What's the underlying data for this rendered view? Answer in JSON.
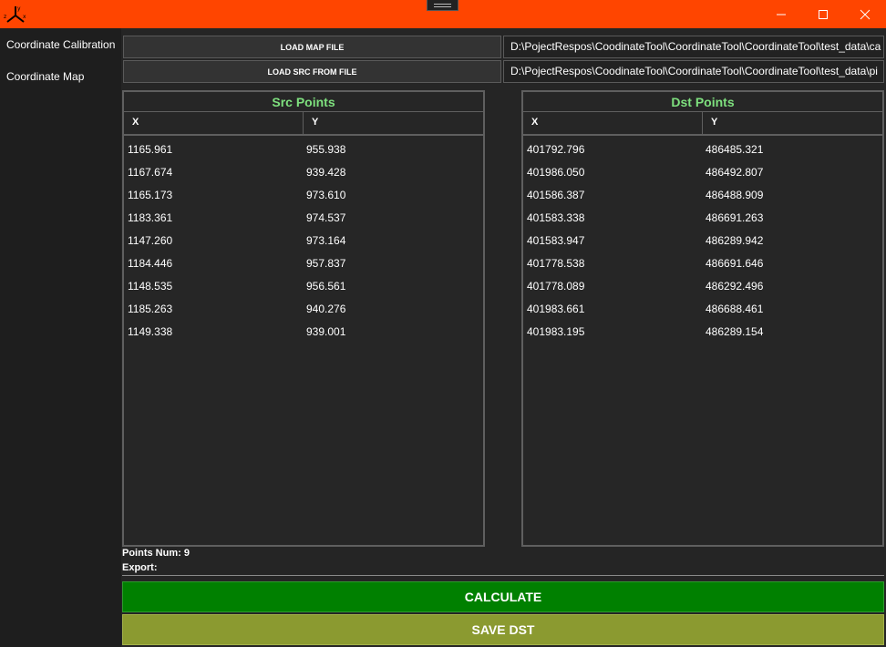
{
  "window": {
    "controls": {
      "minimize_icon": "minimize-icon",
      "maximize_icon": "maximize-icon",
      "close_icon": "close-icon"
    },
    "title_bar_color": "#ff4500"
  },
  "nav": {
    "items": [
      {
        "label": "Coordinate Calibration"
      },
      {
        "label": "Coordinate Map"
      }
    ]
  },
  "loaders": {
    "map": {
      "button_label": "LOAD MAP FILE",
      "path": "D:\\PojectRespos\\CoodinateTool\\CoordinateTool\\CoordinateTool\\test_data\\ca"
    },
    "src": {
      "button_label": "LOAD SRC FROM FILE",
      "path": "D:\\PojectRespos\\CoodinateTool\\CoordinateTool\\CoordinateTool\\test_data\\pi"
    }
  },
  "src_points": {
    "title": "Src Points",
    "columns": [
      "X",
      "Y"
    ],
    "rows": [
      [
        "1165.961",
        "955.938"
      ],
      [
        "1167.674",
        "939.428"
      ],
      [
        "1165.173",
        "973.610"
      ],
      [
        "1183.361",
        "974.537"
      ],
      [
        "1147.260",
        "973.164"
      ],
      [
        "1184.446",
        "957.837"
      ],
      [
        "1148.535",
        "956.561"
      ],
      [
        "1185.263",
        "940.276"
      ],
      [
        "1149.338",
        "939.001"
      ]
    ]
  },
  "dst_points": {
    "title": "Dst Points",
    "columns": [
      "X",
      "Y"
    ],
    "rows": [
      [
        "401792.796",
        "486485.321"
      ],
      [
        "401986.050",
        "486492.807"
      ],
      [
        "401586.387",
        "486488.909"
      ],
      [
        "401583.338",
        "486691.263"
      ],
      [
        "401583.947",
        "486289.942"
      ],
      [
        "401778.538",
        "486691.646"
      ],
      [
        "401778.089",
        "486292.496"
      ],
      [
        "401983.661",
        "486688.461"
      ],
      [
        "401983.195",
        "486289.154"
      ]
    ]
  },
  "status": {
    "points_num": "Points Num: 9",
    "export": "Export:"
  },
  "actions": {
    "calculate": "CALCULATE",
    "save_dst": "SAVE DST",
    "calculate_color": "#008000",
    "save_color": "#8b9a30"
  }
}
